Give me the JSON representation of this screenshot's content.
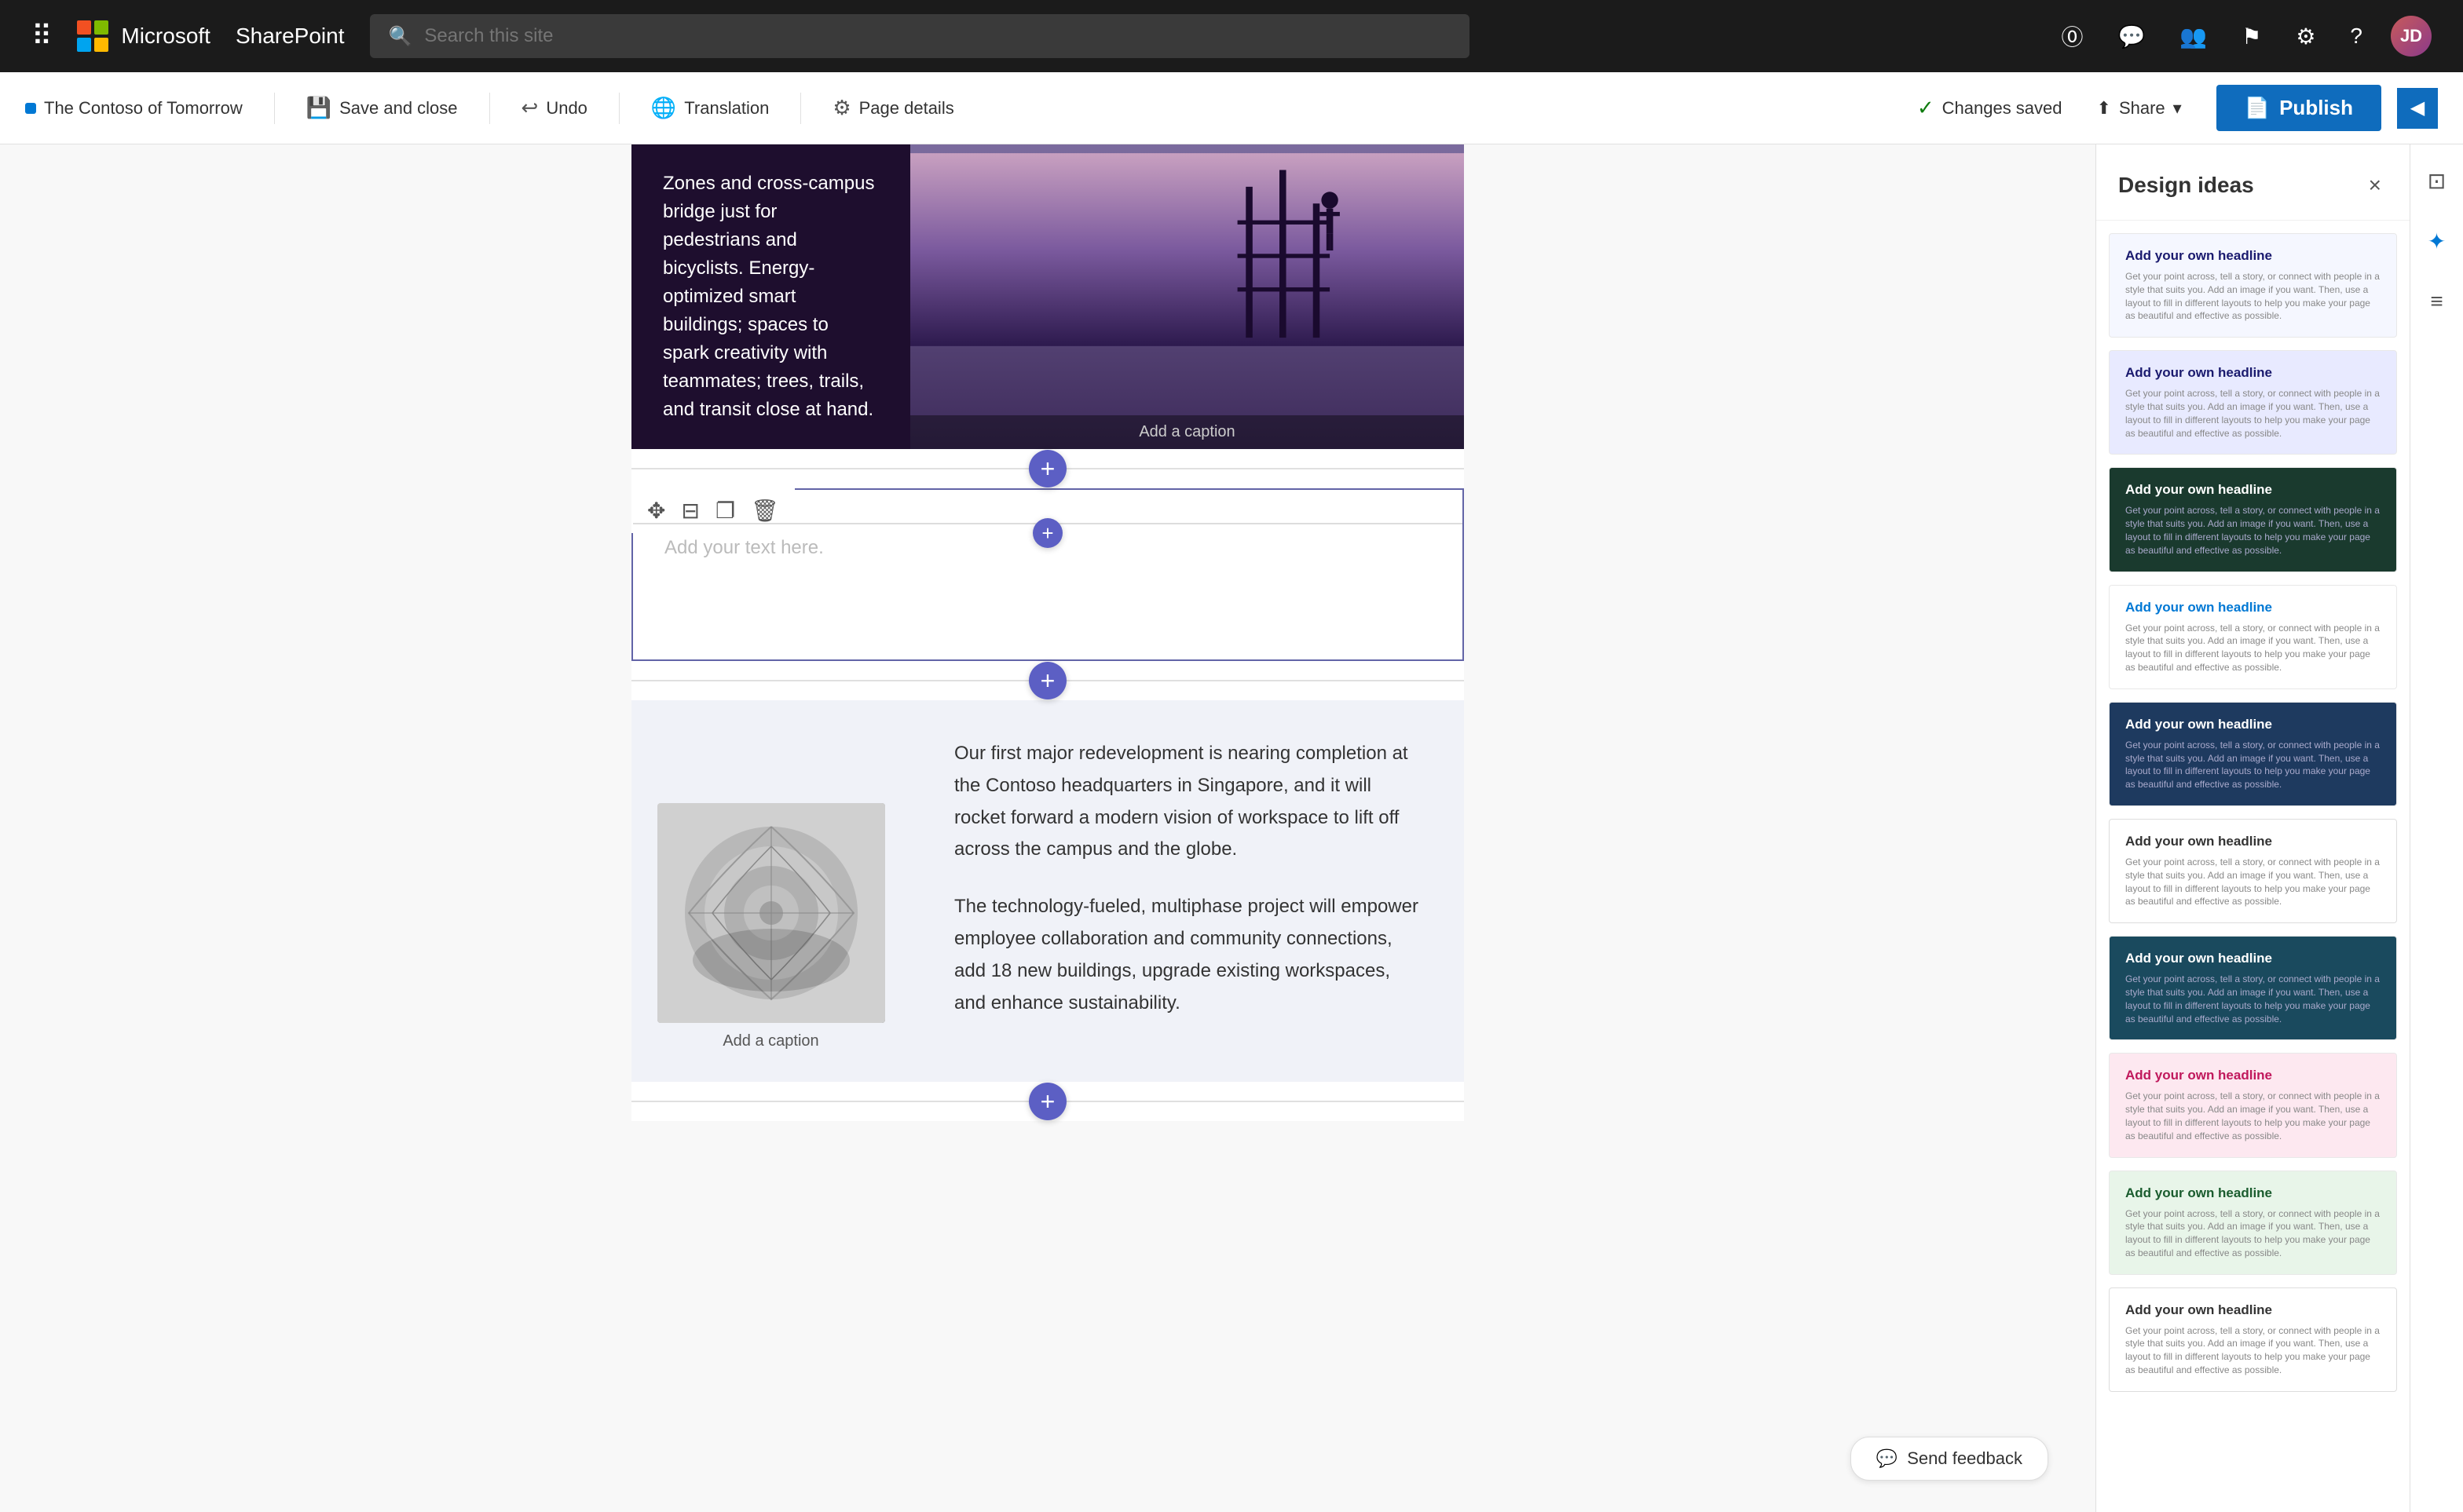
{
  "topnav": {
    "waffle_label": "⊞",
    "brand": "Microsoft",
    "app": "SharePoint",
    "search_placeholder": "Search this site",
    "icons": [
      "help-icon",
      "chat-icon",
      "people-icon",
      "flag-icon",
      "settings-icon",
      "question-icon"
    ],
    "avatar_initials": "JD"
  },
  "toolbar": {
    "page_name": "The Contoso of Tomorrow",
    "save_close_label": "Save and close",
    "undo_label": "Undo",
    "translation_label": "Translation",
    "page_details_label": "Page details",
    "changes_saved_label": "Changes saved",
    "share_label": "Share",
    "publish_label": "Publish"
  },
  "content": {
    "hero_text": "Zones and cross-campus bridge just for pedestrians and bicyclists. Energy-optimized smart buildings; spaces to spark creativity with teammates; trees, trails, and transit close at hand.",
    "hero_caption": "Add a caption",
    "text_placeholder": "Add your text here.",
    "bottom_caption": "Add a caption",
    "bottom_para1": "Our first major redevelopment is nearing completion at the Contoso headquarters in Singapore, and it will rocket forward a modern vision of workspace to lift off across the campus and the globe.",
    "bottom_para2": "The technology-fueled, multiphase project will empower employee collaboration and community connections, add 18 new buildings, upgrade existing workspaces, and enhance sustainability.",
    "send_feedback_label": "Send feedback"
  },
  "design_panel": {
    "title": "Design ideas",
    "close_label": "×",
    "ideas": [
      {
        "id": 1,
        "style": "style-light",
        "headline": "Add your own headline",
        "text": "Get your point across, tell a story, or connect with people in a style that suits you. Add an image if you want. Then, use a layout to fill in different layouts to help you make your page as beautiful and effective as possible."
      },
      {
        "id": 2,
        "style": "style-lavender",
        "headline": "Add your own headline",
        "text": "Get your point across, tell a story, or connect with people in a style that suits you. Add an image if you want. Then, use a layout to fill in different layouts to help you make your page as beautiful and effective as possible."
      },
      {
        "id": 3,
        "style": "style-dark-green",
        "headline": "Add your own headline",
        "text": "Get your point across, tell a story, or connect with people in a style that suits you. Add an image if you want. Then, use a layout to fill in different layouts to help you make your page as beautiful and effective as possible."
      },
      {
        "id": 4,
        "style": "style-white-2",
        "headline": "Add your own headline",
        "text": "Get your point across, tell a story, or connect with people in a style that suits you. Add an image if you want. Then, use a layout to fill in different layouts to help you make your page as beautiful and effective as possible."
      },
      {
        "id": 5,
        "style": "style-dark-blue",
        "headline": "Add your own headline",
        "text": "Get your point across, tell a story, or connect with people in a style that suits you. Add an image if you want. Then, use a layout to fill in different layouts to help you make your page as beautiful and effective as possible."
      },
      {
        "id": 6,
        "style": "style-white-3",
        "headline": "Add your own headline",
        "text": "Get your point across, tell a story, or connect with people in a style that suits you. Add an image if you want. Then, use a layout to fill in different layouts to help you make your page as beautiful and effective as possible."
      },
      {
        "id": 7,
        "style": "style-teal",
        "headline": "Add your own headline",
        "text": "Get your point across, tell a story, or connect with people in a style that suits you. Add an image if you want. Then, use a layout to fill in different layouts to help you make your page as beautiful and effective as possible."
      },
      {
        "id": 8,
        "style": "style-pink",
        "headline": "Add your own headline",
        "text": "Get your point across, tell a story, or connect with people in a style that suits you. Add an image if you want. Then, use a layout to fill in different layouts to help you make your page as beautiful and effective as possible."
      },
      {
        "id": 9,
        "style": "style-green-light",
        "headline": "Add your own headline",
        "text": "Get your point across, tell a story, or connect with people in a style that suits you. Add an image if you want. Then, use a layout to fill in different layouts to help you make your page as beautiful and effective as possible."
      },
      {
        "id": 10,
        "style": "style-white-4",
        "headline": "Add your own headline",
        "text": "Get your point across, tell a story, or connect with people in a style that suits you. Add an image if you want. Then, use a layout to fill in different layouts to help you make your page as beautiful and effective as possible."
      }
    ]
  }
}
